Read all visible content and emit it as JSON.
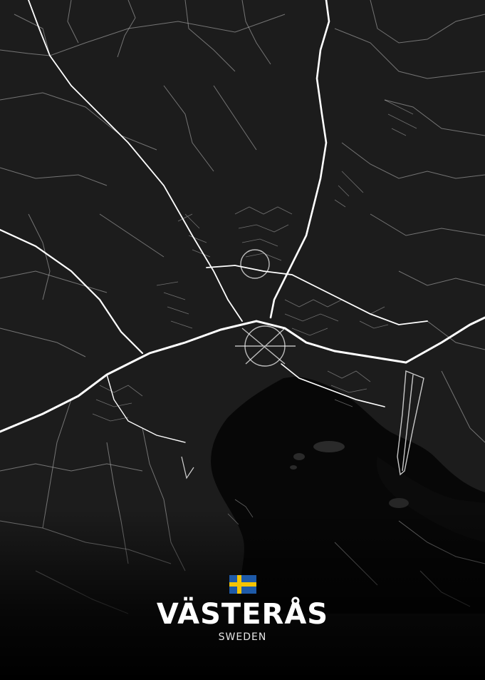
{
  "poster": {
    "city": "VÄSTERÅS",
    "country": "SWEDEN",
    "flag_icon": "sweden-flag-icon"
  },
  "colors": {
    "background": "#1c1c1c",
    "water": "#070707",
    "roads": "#ffffff",
    "flag_blue": "#1e5aa8",
    "flag_yellow": "#f5c400",
    "title": "#ffffff"
  }
}
